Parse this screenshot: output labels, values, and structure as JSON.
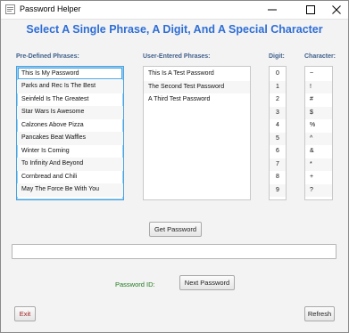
{
  "window": {
    "title": "Password Helper",
    "accent": "#2e6ed6"
  },
  "heading": "Select A Single Phrase, A Digit, And A Special Character",
  "columns": {
    "predefined": "Pre-Defined Phrases:",
    "user": "User-Entered Phrases:",
    "digit": "Digit:",
    "character": "Character:"
  },
  "predefined_phrases": [
    "This Is My Password",
    "Parks and Rec Is The Best",
    "Seinfeld Is The Greatest",
    "Star Wars Is Awesome",
    "Calzones Above Pizza",
    "Pancakes Beat Waffles",
    "Winter Is Coming",
    "To Infinity And Beyond",
    "Cornbread and Chili",
    "May The Force Be With You"
  ],
  "user_phrases": [
    "This Is A Test Password",
    "The Second Test Password",
    "A Third Test Password"
  ],
  "digits": [
    "0",
    "1",
    "2",
    "3",
    "4",
    "5",
    "6",
    "7",
    "8",
    "9"
  ],
  "characters": [
    "~",
    "!",
    "#",
    "$",
    "%",
    "^",
    "&",
    "*",
    "+",
    "?"
  ],
  "buttons": {
    "get_password": "Get Password",
    "next_password": "Next Password",
    "exit": "Exit",
    "refresh": "Refresh"
  },
  "password_id_label": "Password ID:",
  "password_output": ""
}
